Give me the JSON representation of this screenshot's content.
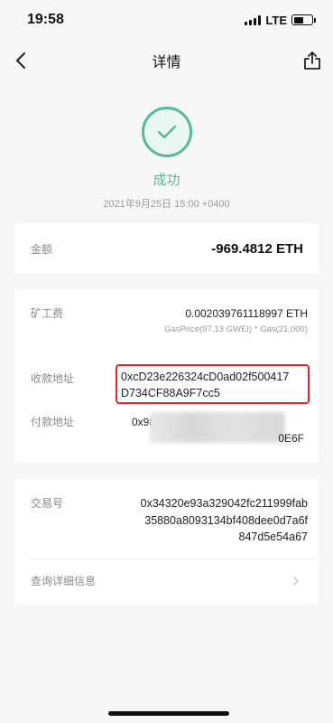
{
  "status_bar": {
    "time": "19:58",
    "network": "LTE"
  },
  "nav": {
    "title": "详情"
  },
  "result": {
    "status": "成功",
    "date": "2021年9月25日 15:00 +0400"
  },
  "amount": {
    "label": "金额",
    "value": "-969.4812 ETH"
  },
  "fee": {
    "label": "矿工费",
    "value": "0.002039761118997 ETH",
    "detail": "GasPrice(97.13 GWEI) * Gas(21,000)"
  },
  "to": {
    "label": "收款地址",
    "line1": "0xcD23e226324cD0ad02f500417",
    "line2": "D734CF88A9F7cc5"
  },
  "from": {
    "label": "付款地址",
    "prefix": "0x98",
    "suffix": "0E6F"
  },
  "tx": {
    "label": "交易号",
    "line1": "0x34320e93a329042fc211999fab",
    "line2": "35880a8093134bf408dee0d7a6f",
    "line3": "847d5e54a67"
  },
  "query": {
    "label": "查询详细信息"
  },
  "colors": {
    "success": "#59b89a",
    "highlight": "#e8232e"
  }
}
